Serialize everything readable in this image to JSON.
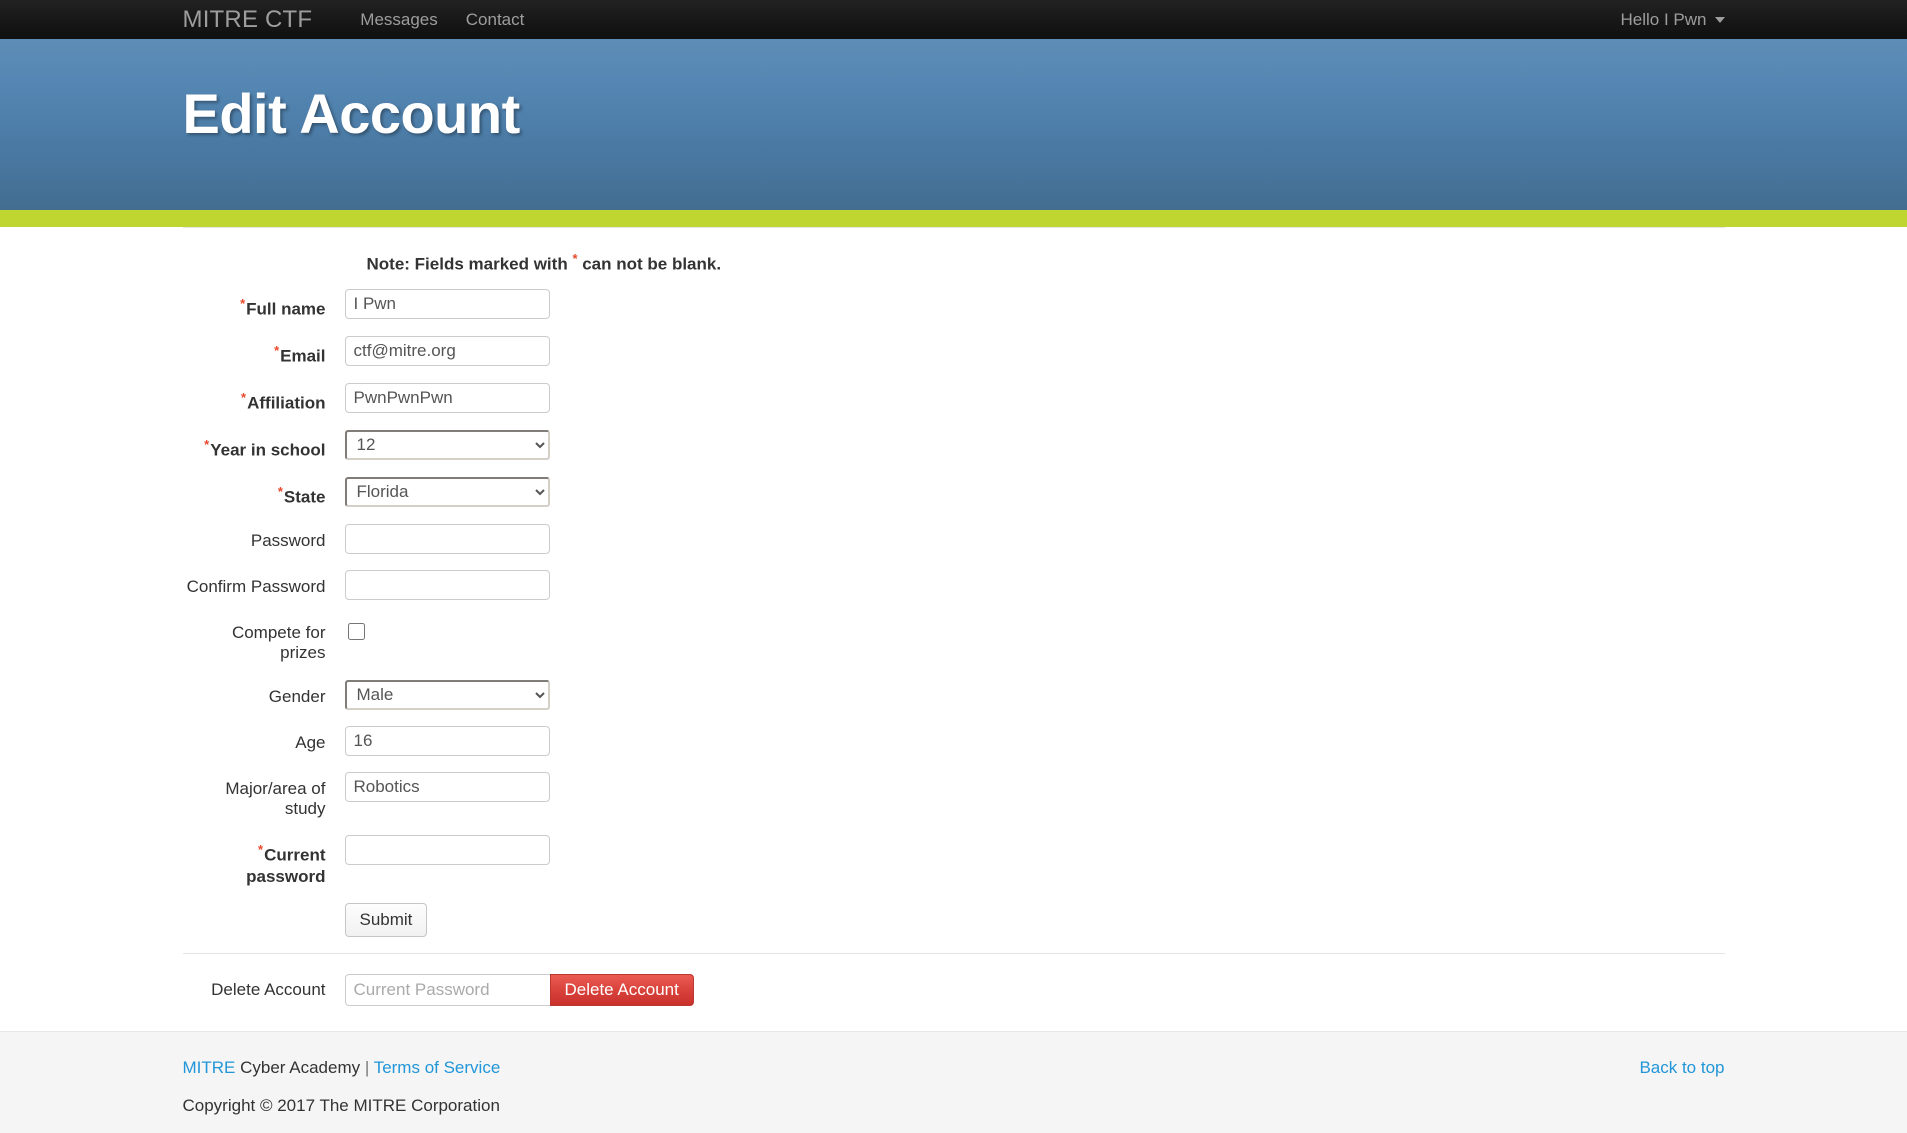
{
  "navbar": {
    "brand": "MITRE CTF",
    "links": [
      {
        "label": "Messages"
      },
      {
        "label": "Contact"
      }
    ],
    "user_menu": "Hello I Pwn",
    "caret_icon": "chevron-down-icon"
  },
  "banner": {
    "title": "Edit Account",
    "accent_color": "#bed62f",
    "bg_color_top": "#5e8db7",
    "bg_color_bottom": "#436d90"
  },
  "note": {
    "before": "Note: Fields marked with ",
    "star": "*",
    "after": " can not be blank.",
    "required_color": "#e8492c"
  },
  "form": {
    "fields": [
      {
        "label": "Full name",
        "required": true,
        "type": "text",
        "value": "I Pwn",
        "placeholder": ""
      },
      {
        "label": "Email",
        "required": true,
        "type": "text",
        "value": "ctf@mitre.org",
        "placeholder": ""
      },
      {
        "label": "Affiliation",
        "required": true,
        "type": "text",
        "value": "PwnPwnPwn",
        "placeholder": ""
      },
      {
        "label": "Year in school",
        "required": true,
        "type": "select",
        "value": "12",
        "placeholder": ""
      },
      {
        "label": "State",
        "required": true,
        "type": "select",
        "value": "Florida",
        "placeholder": ""
      },
      {
        "label": "Password",
        "required": false,
        "type": "password",
        "value": "",
        "placeholder": ""
      },
      {
        "label": "Confirm Password",
        "required": false,
        "type": "password",
        "value": "",
        "placeholder": ""
      },
      {
        "label": "Compete for prizes",
        "required": false,
        "type": "checkbox",
        "value": "",
        "checked": false
      },
      {
        "label": "Gender",
        "required": false,
        "type": "select",
        "value": "Male",
        "placeholder": ""
      },
      {
        "label": "Age",
        "required": false,
        "type": "text",
        "value": "16",
        "placeholder": ""
      },
      {
        "label": "Major/area of study",
        "required": false,
        "type": "text",
        "value": "Robotics",
        "placeholder": ""
      },
      {
        "label": "Current password",
        "required": true,
        "type": "password",
        "value": "",
        "placeholder": ""
      }
    ],
    "submit_label": "Submit"
  },
  "delete_section": {
    "label": "Delete Account",
    "password_placeholder": "Current Password",
    "password_value": "",
    "button_label": "Delete Account",
    "button_color": "#c9302c"
  },
  "footer": {
    "brand_link": "MITRE",
    "brand_rest": " Cyber Academy ",
    "separator": "| ",
    "terms_link": "Terms of Service",
    "copyright": "Copyright © 2017 The MITRE Corporation",
    "back_to_top": "Back to top",
    "link_color": "#2196d8"
  }
}
